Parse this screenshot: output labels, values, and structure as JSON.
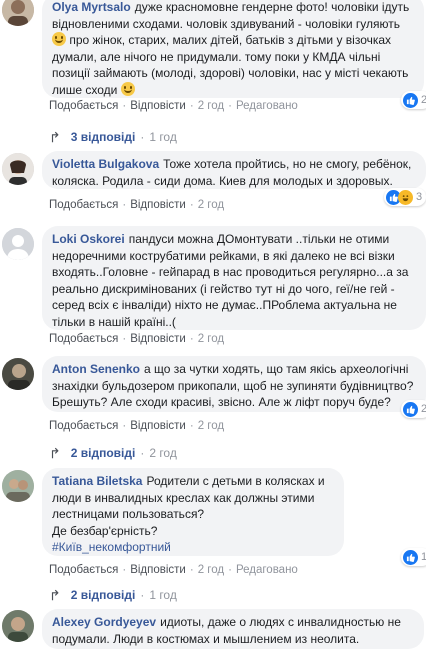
{
  "comments": [
    {
      "author": "Olya Myrtsalo",
      "text1": "дуже красномовне гендерне фото! чоловіки ідуть відновленими сходами. чоловік здивуваний - чоловіки гуляють ",
      "text2": " про жінок, старих, малих дітей, батьків з дітьми у візочках думали, але нічого не придумали. тому поки у КМДА чільні позиції займають (молоді, здорові) чоловіки, нас у місті чекають лише сходи ",
      "like": "Подобається",
      "reply": "Відповісти",
      "time": "2 год",
      "edited": "Редаговано",
      "reaction_count": "2",
      "replies_label": "3 відповіді",
      "replies_time": "1 год"
    },
    {
      "author": "Violetta Bulgakova",
      "text": "Тоже хотела пройтись, но не смогу, ребёнок, коляска. Родила - сиди дома. Киев для молодых и здоровых.",
      "like": "Подобається",
      "reply": "Відповісти",
      "time": "2 год",
      "reaction_count": "3"
    },
    {
      "author": "Loki Oskorei",
      "text": "пандуси можна ДОмонтувати ..тільки не отими недоречними кострубатими рейками, в які далеко не всі візки входять..Головне - гейпарад в нас проводиться регулярно...а за реально дискримінованих (і гейство тут ні до чого, геї/не гей - серед всіх є інваліди) ніхто не думає..ПРоблема актуальна не тільки в нашій країні..(",
      "like": "Подобається",
      "reply": "Відповісти",
      "time": "2 год"
    },
    {
      "author": "Anton Senenko",
      "text": "а що за чутки ходять, що там якісь археологічні знахідки бульдозером прикопали, щоб не зупиняти будівництво? Брешуть? Але сходи красиві, звісно. Але ж ліфт поруч буде?",
      "like": "Подобається",
      "reply": "Відповісти",
      "time": "2 год",
      "reaction_count": "2",
      "replies_label": "2 відповіді",
      "replies_time": "2 год"
    },
    {
      "author": "Tatiana Biletska",
      "text": "Родители с детьми в колясках и люди в инвалидных креслах как должны этими лестницами пользоваться?",
      "text_line2": "Де безбар'єрність?",
      "hashtag": "#Київ_некомфортний",
      "like": "Подобається",
      "reply": "Відповісти",
      "time": "2 год",
      "edited": "Редаговано",
      "reaction_count": "1",
      "replies_label": "2 відповіді",
      "replies_time": "1 год"
    },
    {
      "author": "Alexey Gordyeyev",
      "text": "идиоты, даже о людях с инвалидностью не подумали. Люди в костюмах и мышлением из неолита."
    }
  ],
  "colors": {
    "link": "#385898",
    "bubble": "#f2f3f5",
    "meta": "#90949c",
    "like_blue": "#1877f2"
  },
  "icons": {
    "reply_arrow": "reply-arrow-icon",
    "like": "like-reaction-icon",
    "haha": "haha-reaction-icon",
    "smile": "smile-emoji-icon"
  }
}
